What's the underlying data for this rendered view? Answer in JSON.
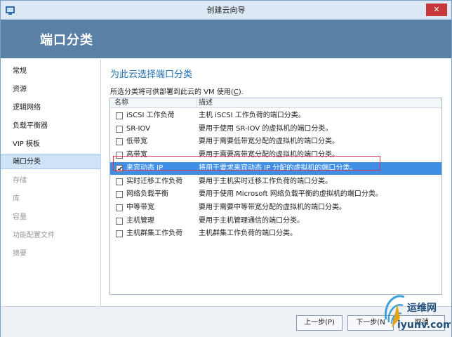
{
  "window": {
    "title": "创建云向导",
    "close_label": "✕"
  },
  "header": {
    "title": "端口分类"
  },
  "sidebar": {
    "items": [
      {
        "label": "常规",
        "state": "normal"
      },
      {
        "label": "资源",
        "state": "normal"
      },
      {
        "label": "逻辑网络",
        "state": "normal"
      },
      {
        "label": "负载平衡器",
        "state": "normal"
      },
      {
        "label": "VIP 模板",
        "state": "normal"
      },
      {
        "label": "端口分类",
        "state": "active"
      },
      {
        "label": "存储",
        "state": "disabled"
      },
      {
        "label": "库",
        "state": "disabled"
      },
      {
        "label": "容量",
        "state": "disabled"
      },
      {
        "label": "功能配置文件",
        "state": "disabled"
      },
      {
        "label": "摘要",
        "state": "disabled"
      }
    ]
  },
  "main": {
    "title": "为此云选择端口分类",
    "description_prefix": "所选分类将可供部署到此云的 VM 使用(",
    "description_hotkey": "C",
    "description_suffix": ").",
    "grid": {
      "columns": [
        "名称",
        "描述"
      ],
      "rows": [
        {
          "name": "iSCSI 工作负荷",
          "desc": "主机 iSCSI 工作负荷的端口分类。",
          "checked": false
        },
        {
          "name": "SR-IOV",
          "desc": "要用于使用 SR-IOV 的虚拟机的端口分类。",
          "checked": false
        },
        {
          "name": "低带宽",
          "desc": "要用于需要低带宽分配的虚拟机的端口分类。",
          "checked": false
        },
        {
          "name": "高带宽",
          "desc": "要用于需要高带宽分配的虚拟机的端口分类。",
          "checked": false
        },
        {
          "name": "来宾动态 IP",
          "desc": "将用于要求来宾动态 IP 分配的虚拟机的端口分类。",
          "checked": true
        },
        {
          "name": "实时迁移工作负荷",
          "desc": "要用于主机实时迁移工作负荷的端口分类。",
          "checked": false
        },
        {
          "name": "网络负载平衡",
          "desc": "要用于使用 Microsoft 网络负载平衡的虚拟机的端口分类。",
          "checked": false
        },
        {
          "name": "中等带宽",
          "desc": "要用于需要中等带宽分配的虚拟机的端口分类。",
          "checked": false
        },
        {
          "name": "主机管理",
          "desc": "要用于主机管理通信的端口分类。",
          "checked": false
        },
        {
          "name": "主机群集工作负荷",
          "desc": "主机群集工作负荷的端口分类。",
          "checked": false
        }
      ]
    }
  },
  "footer": {
    "prev_label": "上一步(P)",
    "next_label": "下一步(N",
    "cancel_label": "取消"
  },
  "watermark": {
    "title": "运维网",
    "url": "iyunv.com"
  },
  "colors": {
    "header_band": "#5a80a6",
    "selected_row": "#3f8fe6",
    "highlight_border": "#d63a5a",
    "accent_title": "#1f6fb5"
  }
}
